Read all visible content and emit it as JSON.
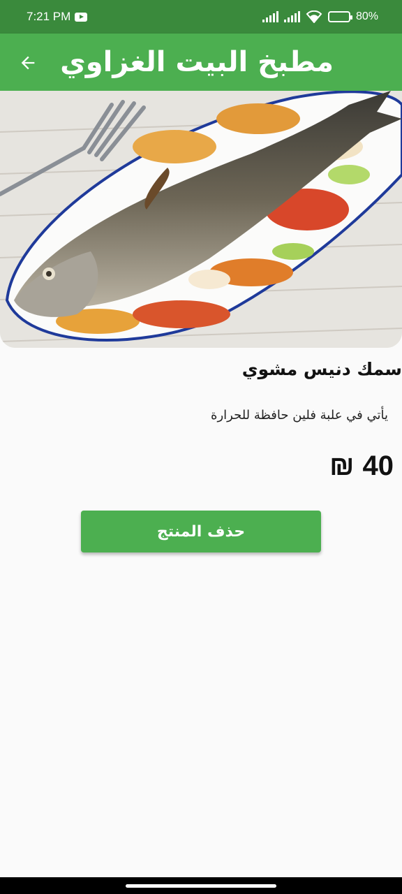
{
  "status_bar": {
    "time": "7:21 PM",
    "battery_text": "80%",
    "battery_level": 0.8,
    "icons": [
      "youtube-icon",
      "signal-icon",
      "signal-icon",
      "wifi-icon",
      "battery-icon"
    ]
  },
  "app_bar": {
    "title": "مطبخ البيت الغزاوي",
    "back_icon": "arrow-back-icon"
  },
  "product": {
    "image_alt": "grilled-fish-image",
    "name": "سمك دنيس مشوي",
    "description": "يأتي في علبة فلين حافظة للحرارة",
    "price": "40",
    "currency_symbol": "₪"
  },
  "actions": {
    "delete_label": "حذف المنتج"
  },
  "colors": {
    "primary": "#4caf50",
    "status_bar": "#3a8a3c",
    "background": "#fafafa"
  }
}
